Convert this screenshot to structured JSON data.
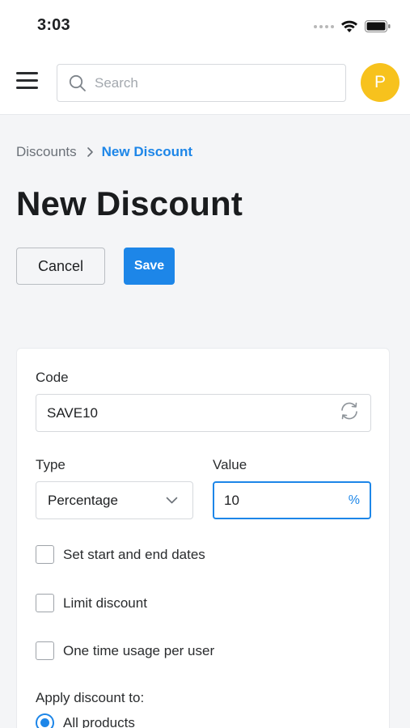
{
  "status_bar": {
    "time": "3:03"
  },
  "header": {
    "search_placeholder": "Search",
    "avatar_initial": "P"
  },
  "breadcrumb": {
    "parent": "Discounts",
    "current": "New Discount"
  },
  "page_title": "New Discount",
  "actions": {
    "cancel_label": "Cancel",
    "save_label": "Save"
  },
  "form": {
    "code_label": "Code",
    "code_value": "SAVE10",
    "type_label": "Type",
    "type_value": "Percentage",
    "value_label": "Value",
    "value_value": "10",
    "value_unit": "%",
    "checkboxes": [
      {
        "label": "Set start and end dates",
        "checked": false
      },
      {
        "label": "Limit discount",
        "checked": false
      },
      {
        "label": "One time usage per user",
        "checked": false
      }
    ],
    "apply_label": "Apply discount to:",
    "apply_option": "All products"
  },
  "colors": {
    "accent": "#1d86e8",
    "avatar": "#f7c21d",
    "background": "#f4f5f7"
  }
}
